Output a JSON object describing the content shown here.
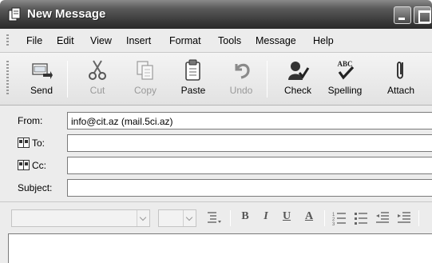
{
  "window": {
    "title": "New Message"
  },
  "menu": {
    "items": [
      "File",
      "Edit",
      "View",
      "Insert",
      "Format",
      "Tools",
      "Message",
      "Help"
    ]
  },
  "toolbar": {
    "buttons": [
      {
        "label": "Send",
        "icon": "send-icon",
        "enabled": true
      },
      {
        "label": "Cut",
        "icon": "scissors-icon",
        "enabled": false
      },
      {
        "label": "Copy",
        "icon": "copy-icon",
        "enabled": false
      },
      {
        "label": "Paste",
        "icon": "paste-icon",
        "enabled": true
      },
      {
        "label": "Undo",
        "icon": "undo-icon",
        "enabled": false
      },
      {
        "label": "Check",
        "icon": "check-names-icon",
        "enabled": true
      },
      {
        "label": "Spelling",
        "icon": "spelling-icon",
        "enabled": true
      },
      {
        "label": "Attach",
        "icon": "paperclip-icon",
        "enabled": true
      }
    ],
    "spelling_icon_text": "ABC"
  },
  "headers": {
    "from_label": "From:",
    "from_value": "info@cit.az   (mail.5ci.az)",
    "to_label": "To:",
    "to_value": "",
    "cc_label": "Cc:",
    "cc_value": "",
    "subject_label": "Subject:",
    "subject_value": ""
  },
  "format": {
    "bold": "B",
    "italic": "I",
    "underline": "U",
    "font_color": "A"
  },
  "colors": {
    "titlebar": "#3c3c3c",
    "chrome": "#ececec",
    "field_border": "#7a7a7a"
  }
}
